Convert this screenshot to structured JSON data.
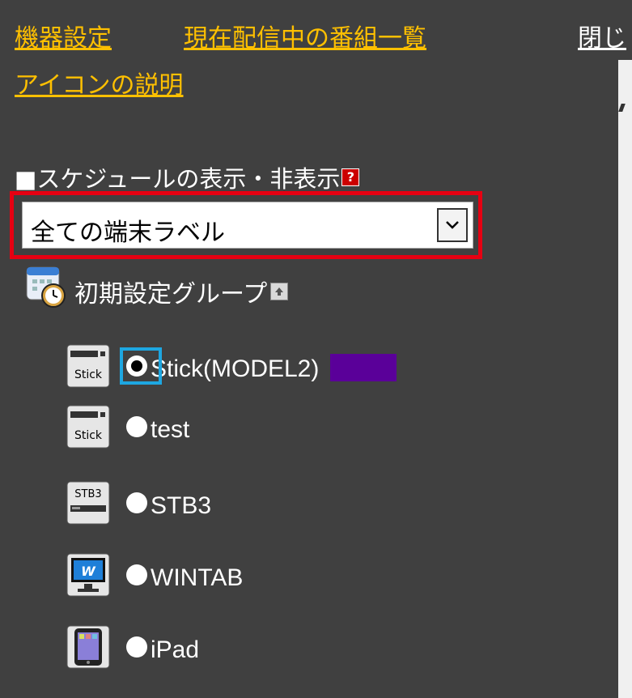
{
  "top_links": {
    "device_settings": "機器設定",
    "current_programs": "現在配信中の番組一覧",
    "icon_description": "アイコンの説明",
    "close": "閉じ"
  },
  "schedule": {
    "title": "■スケジュールの表示・非表示",
    "help_icon_text": "?",
    "selected_label": "全ての端末ラベル"
  },
  "group": {
    "label": "初期設定グループ"
  },
  "devices": [
    {
      "icon": "stick-icon",
      "icon_text": "Stick",
      "label": "Stick(MODEL2)",
      "checked": true,
      "color": "#5a0099"
    },
    {
      "icon": "stick-icon",
      "icon_text": "Stick",
      "label": "test",
      "checked": false
    },
    {
      "icon": "stb3-icon",
      "icon_text": "STB3",
      "label": "STB3",
      "checked": false
    },
    {
      "icon": "wintab-icon",
      "icon_text": "W",
      "label": "WINTAB",
      "checked": false
    },
    {
      "icon": "ipad-icon",
      "icon_text": "",
      "label": "iPad",
      "checked": false
    }
  ],
  "colors": {
    "background": "#404040",
    "link": "#ffc000",
    "highlight_frame": "#e60012",
    "focus_ring": "#1ea7e1"
  }
}
